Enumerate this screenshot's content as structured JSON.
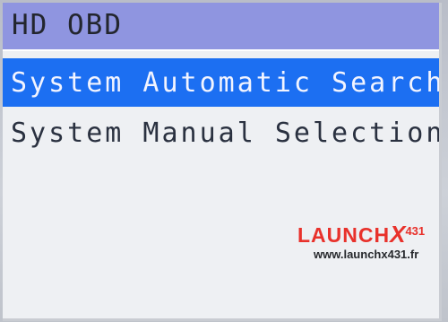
{
  "header": {
    "title": "HD OBD"
  },
  "menu": {
    "items": [
      {
        "label": "System Automatic Search",
        "selected": true
      },
      {
        "label": "System Manual Selection",
        "selected": false
      }
    ]
  },
  "watermark": {
    "brand": "LAUNCH",
    "model_x": "X",
    "model_num": "431",
    "url": "www.launchx431.fr"
  },
  "colors": {
    "title_bar": "#8f95e0",
    "highlight": "#1c6ff2",
    "screen_bg": "#eef0f3",
    "brand_red": "#e8312b"
  }
}
